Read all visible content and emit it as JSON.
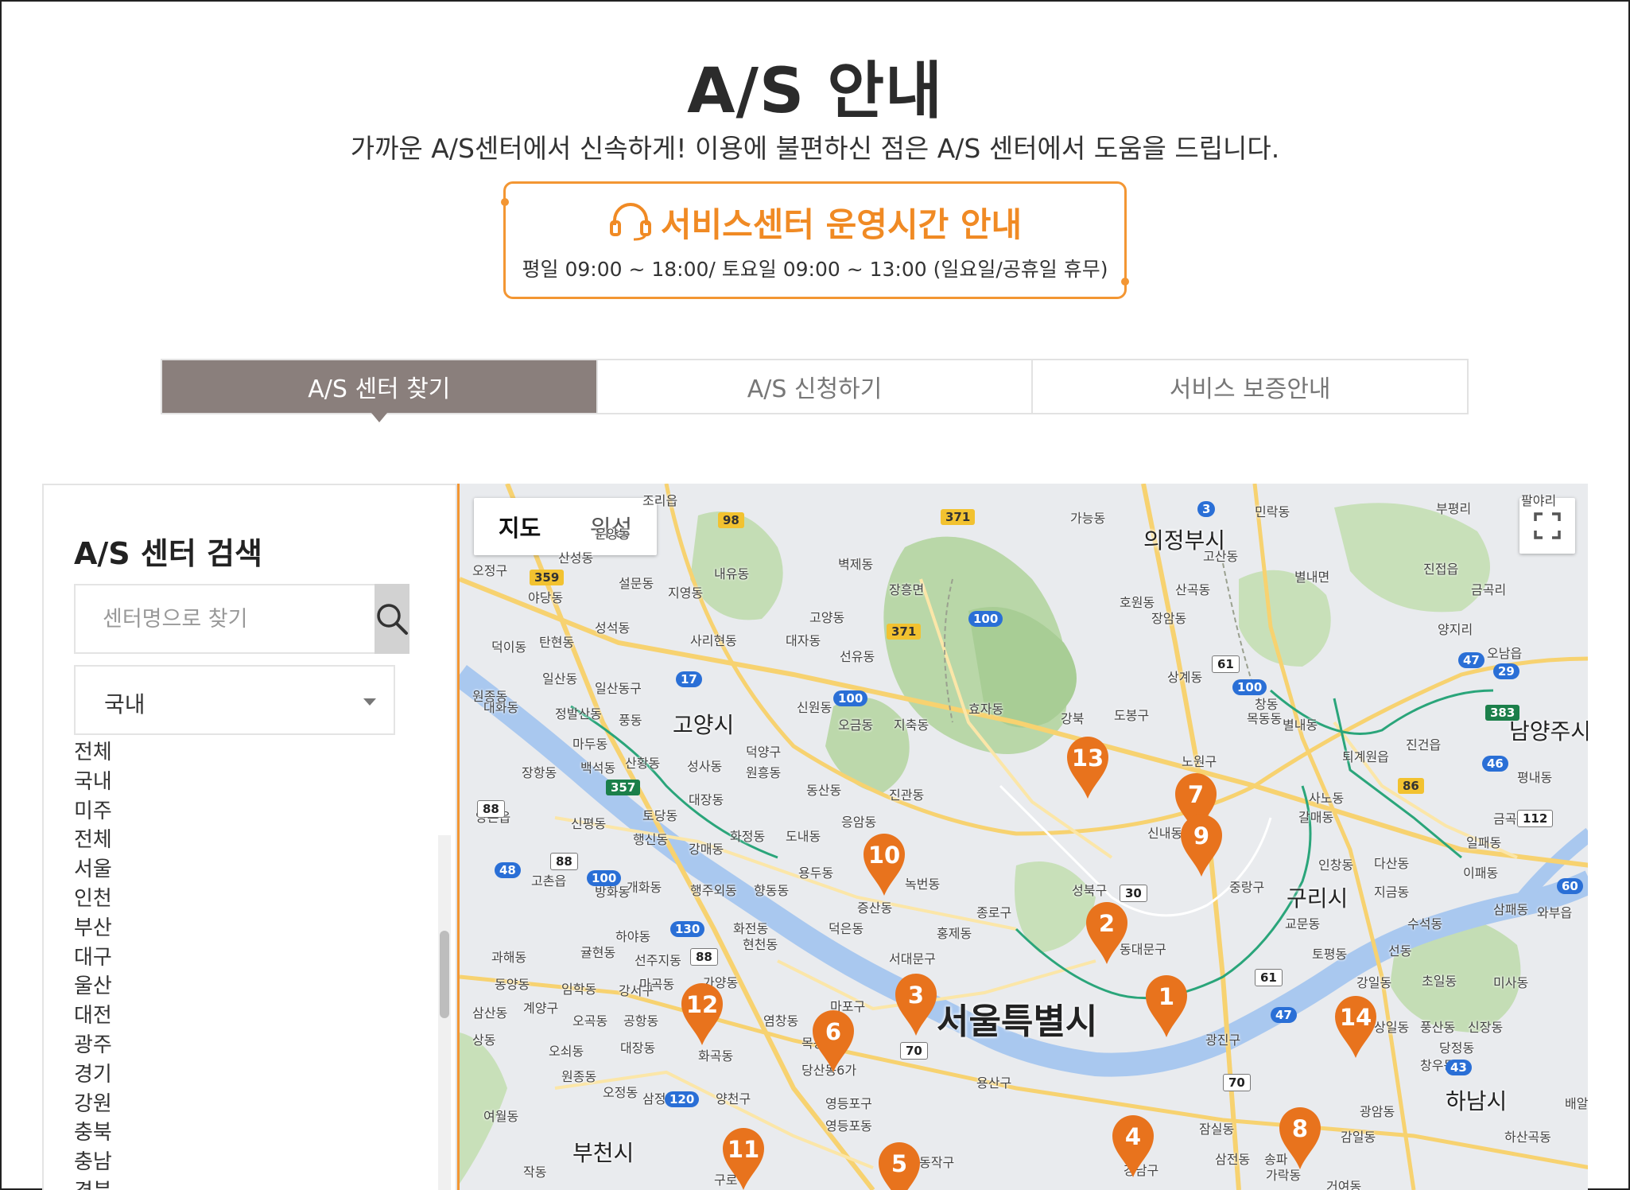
{
  "header": {
    "title": "A/S 안내",
    "subtitle": "가까운 A/S센터에서 신속하게! 이용에 불편하신 점은 A/S 센터에서 도움을 드립니다."
  },
  "hours": {
    "heading": "서비스센터 운영시간 안내",
    "text": "평일 09:00 ~ 18:00/ 토요일 09:00 ~ 13:00 (일요일/공휴일 휴무)",
    "icon": "headset-icon",
    "accent_color": "#f39633"
  },
  "tabs": [
    {
      "label": "A/S 센터 찾기",
      "active": true
    },
    {
      "label": "A/S 신청하기",
      "active": false
    },
    {
      "label": "서비스 보증안내",
      "active": false
    }
  ],
  "sidebar": {
    "title": "A/S 센터 검색",
    "search_placeholder": "센터명으로 찾기",
    "search_icon": "search-icon",
    "select_value": "국내",
    "regions": [
      "전체",
      "국내",
      "미주",
      "전체",
      "서울",
      "인천",
      "부산",
      "대구",
      "울산",
      "대전",
      "광주",
      "경기",
      "강원",
      "충북",
      "충남",
      "경북"
    ]
  },
  "map": {
    "type_buttons": [
      "지도",
      "위성"
    ],
    "fullscreen_icon": "fullscreen-icon",
    "marker_color": "#e8731d",
    "cities": [
      "서울특별시",
      "고양시",
      "의정부시",
      "구리시",
      "남양주시",
      "하남시",
      "부천시"
    ],
    "places": [
      "조리읍",
      "가능동",
      "민락동",
      "부평리",
      "팔야리",
      "장흥면",
      "벽제동",
      "내유동",
      "설문동",
      "지영동",
      "고양동",
      "대자동",
      "선유동",
      "사리현동",
      "성석동",
      "탄현동",
      "덕이동",
      "일산동",
      "일산동구",
      "대화동",
      "정발산동",
      "풍동",
      "마두동",
      "백석동",
      "장항동",
      "산황동",
      "성사동",
      "원흥동",
      "덕양구",
      "동산동",
      "진관동",
      "지축동",
      "오금동",
      "신원동",
      "효자동",
      "도봉구",
      "호원동",
      "장암동",
      "고산동",
      "산곡동",
      "별내면",
      "진접읍",
      "금곡리",
      "양지리",
      "오남읍",
      "상계동",
      "노원구",
      "별내동",
      "퇴계원읍",
      "진건읍",
      "평내동",
      "사노동",
      "갈매동",
      "인창동",
      "다산동",
      "이패동",
      "일패동",
      "금곡동",
      "신내동",
      "중랑구",
      "교문동",
      "지금동",
      "수석동",
      "삼패동",
      "와부읍",
      "토평동",
      "선동",
      "미사동",
      "강일동",
      "상일동",
      "풍산동",
      "당정동",
      "신장동",
      "창우동",
      "초일동",
      "배알",
      "광암동",
      "하산곡동",
      "감일동",
      "거여동",
      "가락동",
      "송파",
      "잠실동",
      "삼전동",
      "강남구",
      "광진구",
      "동대문구",
      "성북구",
      "종로구",
      "서대문구",
      "마포구",
      "용산구",
      "동작구",
      "영등포구",
      "영등포동",
      "당산동6가",
      "양천구",
      "구로구",
      "강서구",
      "목동",
      "화곡동",
      "염창동",
      "가양동",
      "마곡동",
      "공항동",
      "오곡동",
      "오쇠동",
      "대장동",
      "원종동",
      "오정동",
      "삼정동",
      "여월동",
      "작동",
      "삼산동",
      "상동",
      "계양구",
      "임학동",
      "동양동",
      "과해동",
      "귤현동",
      "선주지동",
      "하야동",
      "방화동",
      "개화동",
      "행주외동",
      "강매동",
      "행신동",
      "토당동",
      "대장동",
      "화정동",
      "도내동",
      "용두동",
      "향동동",
      "화전동",
      "현천동",
      "덕은동",
      "증산동",
      "응암동",
      "녹번동",
      "홍제동",
      "신평동",
      "고촌읍",
      "창동",
      "강북",
      "목동동",
      "양촌읍",
      "야당동",
      "산성동",
      "운양동",
      "오정구",
      "원종동"
    ],
    "markers": [
      {
        "number": "1"
      },
      {
        "number": "2"
      },
      {
        "number": "3"
      },
      {
        "number": "4"
      },
      {
        "number": "5"
      },
      {
        "number": "6"
      },
      {
        "number": "7"
      },
      {
        "number": "8"
      },
      {
        "number": "9"
      },
      {
        "number": "10"
      },
      {
        "number": "11"
      },
      {
        "number": "12"
      },
      {
        "number": "13"
      },
      {
        "number": "14"
      }
    ]
  }
}
